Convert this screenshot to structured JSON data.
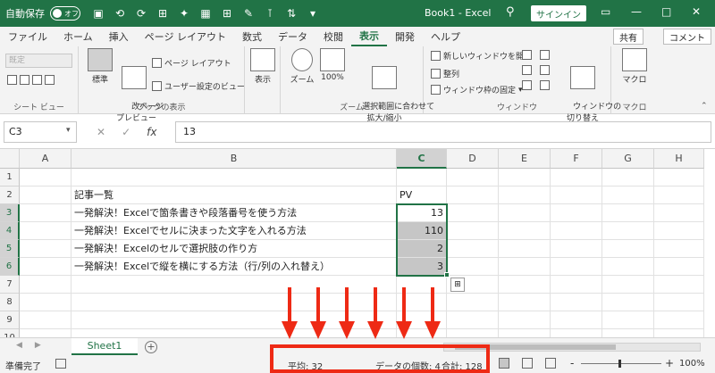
{
  "titlebar": {
    "autosave_label": "自動保存",
    "toggle_label": "オフ",
    "title": "Book1  -  Excel",
    "signin_label": "サインイン",
    "quick_access_icons": [
      "save-icon",
      "undo-icon",
      "redo-icon",
      "table-icon",
      "format-icon",
      "border-icon",
      "grid-icon",
      "paint-icon",
      "filter-icon",
      "sort-icon",
      "customize-icon"
    ]
  },
  "tabs": [
    "ファイル",
    "ホーム",
    "挿入",
    "ページ レイアウト",
    "数式",
    "データ",
    "校閲",
    "表示",
    "開発",
    "ヘルプ"
  ],
  "active_tab_index": 7,
  "ribbon_right": {
    "share_label": "共有",
    "comment_label": "コメント"
  },
  "ribbon": {
    "sheet_view": {
      "dropdown": "既定",
      "label": "シート ビュー"
    },
    "workbook_views": {
      "normal": "標準",
      "page_break": "改ページ\nプレビュー",
      "page_layout": "ページ レイアウト",
      "custom_views": "ユーザー設定のビュー",
      "label": "ブックの表示"
    },
    "show": {
      "label": "表示"
    },
    "zoom": {
      "zoom": "ズーム",
      "hundred": "100%",
      "fit_selection": "選択範囲に合わせて\n拡大/縮小",
      "label": "ズーム"
    },
    "window": {
      "new_window": "新しいウィンドウを開く",
      "arrange": "整列",
      "freeze": "ウィンドウ枠の固定",
      "switch": "ウィンドウの\n切り替え",
      "label": "ウィンドウ"
    },
    "macro": {
      "macro": "マクロ",
      "label": "マクロ"
    }
  },
  "formula_bar": {
    "name_box": "C3",
    "formula": "13",
    "fx_label": "fx"
  },
  "grid": {
    "columns": [
      "A",
      "B",
      "C",
      "D",
      "E",
      "F",
      "G",
      "H"
    ],
    "rows": [
      "1",
      "2",
      "3",
      "4",
      "5",
      "6",
      "7",
      "8",
      "9",
      "10"
    ],
    "selected_column": "C",
    "cells": {
      "B2": "記事一覧",
      "C2": "PV",
      "B3": "一発解決！Excelで箇条書きや段落番号を使う方法",
      "C3": "13",
      "B4": "一発解決！Excelでセルに決まった文字を入れる方法",
      "C4": "110",
      "B5": "一発解決！Excelのセルで選択肢の作り方",
      "C5": "2",
      "B6": "一発解決！Excelで縦を横にする方法（行/列の入れ替え）",
      "C6": "3"
    }
  },
  "sheets": {
    "active": "Sheet1",
    "add_label": "+"
  },
  "statusbar": {
    "ready": "準備完了",
    "average": "平均: 32",
    "count": "データの個数: 4",
    "sum": "合計: 128",
    "zoom": "100%",
    "zoom_minus": "-",
    "zoom_plus": "+"
  },
  "annotation": {
    "highlight_color": "#ee2a15",
    "arrow_count": 6
  }
}
